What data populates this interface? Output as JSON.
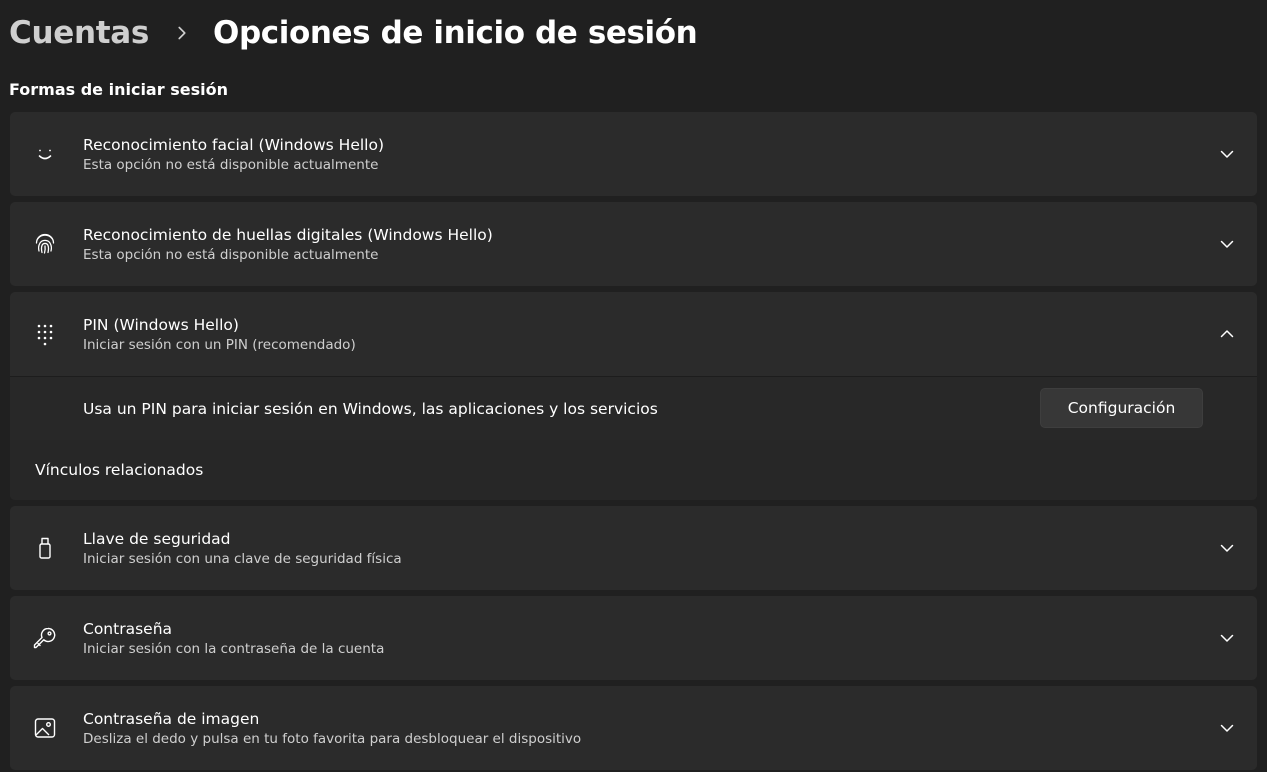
{
  "breadcrumb": {
    "parent": "Cuentas",
    "current": "Opciones de inicio de sesión"
  },
  "section": {
    "title": "Formas de iniciar sesión"
  },
  "options": {
    "face": {
      "title": "Reconocimiento facial (Windows Hello)",
      "subtitle": "Esta opción no está disponible actualmente",
      "icon": "smile-face-icon"
    },
    "fingerprint": {
      "title": "Reconocimiento de huellas digitales (Windows Hello)",
      "subtitle": "Esta opción no está disponible actualmente",
      "icon": "fingerprint-icon"
    },
    "pin": {
      "title": "PIN (Windows Hello)",
      "subtitle": "Iniciar sesión con un PIN (recomendado)",
      "icon": "keypad-dots-icon",
      "expanded": true,
      "description": "Usa un PIN para iniciar sesión en Windows, las aplicaciones y los servicios",
      "button_label": "Configuración",
      "related_label": "Vínculos relacionados"
    },
    "security_key": {
      "title": "Llave de seguridad",
      "subtitle": "Iniciar sesión con una clave de seguridad física",
      "icon": "usb-key-icon"
    },
    "password": {
      "title": "Contraseña",
      "subtitle": "Iniciar sesión con la contraseña de la cuenta",
      "icon": "key-icon"
    },
    "picture_password": {
      "title": "Contraseña de imagen",
      "subtitle": "Desliza el dedo y pulsa en tu foto favorita para desbloquear el dispositivo",
      "icon": "picture-icon"
    }
  },
  "colors": {
    "background": "#202020",
    "card": "#2b2b2b",
    "text_primary": "#ffffff",
    "text_secondary": "#cfcfcf"
  }
}
